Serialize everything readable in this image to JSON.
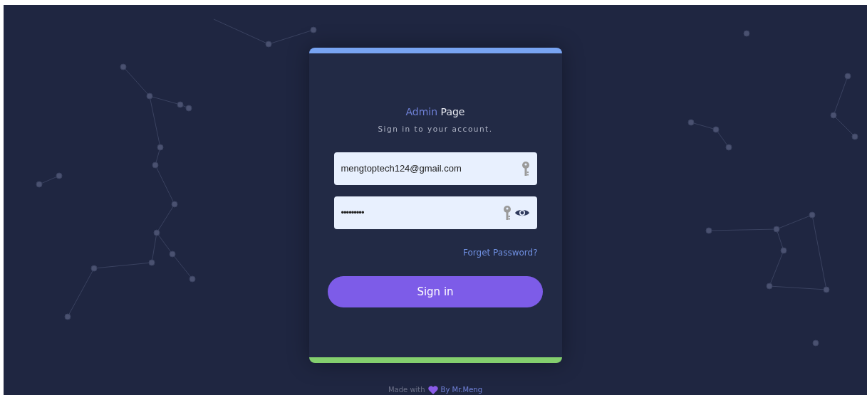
{
  "login": {
    "title_accent": "Admin",
    "title_rest": "Page",
    "subtitle": "Sign in to your account.",
    "fields": [
      {
        "kind": "email",
        "value": "mengtoptech124@gmail.com"
      },
      {
        "kind": "password",
        "value": "•••••••••"
      }
    ],
    "forgot_link": "Forget Password?",
    "submit": "Sign in"
  },
  "footer": {
    "prefix": "Made with",
    "author_link": "By Mr.Meng"
  }
}
